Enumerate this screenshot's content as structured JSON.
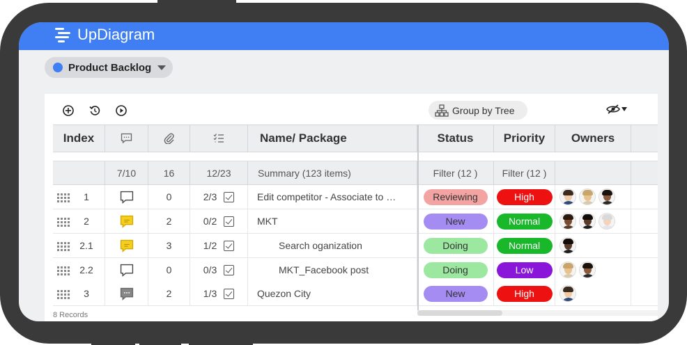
{
  "app": {
    "title": "UpDiagram"
  },
  "project": {
    "label": "Product Backlog",
    "color": "#3f7ef3"
  },
  "toolbar": {
    "add_icon": "add-circle-icon",
    "history_icon": "history-icon",
    "play_icon": "play-circle-icon",
    "group_by_label": "Group by Tree",
    "hide_icon": "eye-hidden-icon"
  },
  "columns": {
    "index": "Index",
    "comments": "comment-icon",
    "attachments": "paperclip-icon",
    "subtasks": "checklist-icon",
    "name": "Name/ Package",
    "status": "Status",
    "priority": "Priority",
    "owners": "Owners"
  },
  "summary": {
    "comments": "7/10",
    "attachments": "16",
    "subtasks": "12/23",
    "name": "Summary (123 items)",
    "status": "Filter (12 )",
    "priority": "Filter (12 )"
  },
  "rows": [
    {
      "index": "1",
      "comment_state": "empty",
      "attachments": "0",
      "subtasks": "2/3",
      "name": "Edit competitor - Associate to …",
      "indent": 0,
      "status": "Reviewing",
      "priority": "High",
      "owners": 3
    },
    {
      "index": "2",
      "comment_state": "new",
      "attachments": "2",
      "subtasks": "0/2",
      "name": "MKT",
      "indent": 0,
      "status": "New",
      "priority": "Normal",
      "owners": 3
    },
    {
      "index": "2.1",
      "comment_state": "new",
      "attachments": "3",
      "subtasks": "1/2",
      "name": "Search oganization",
      "indent": 1,
      "status": "Doing",
      "priority": "Normal",
      "owners": 1
    },
    {
      "index": "2.2",
      "comment_state": "empty",
      "attachments": "0",
      "subtasks": "0/3",
      "name": "MKT_Facebook post",
      "indent": 1,
      "status": "Doing",
      "priority": "Low",
      "owners": 2
    },
    {
      "index": "3",
      "comment_state": "read",
      "attachments": "2",
      "subtasks": "1/3",
      "name": "Quezon City",
      "indent": 0,
      "status": "New",
      "priority": "High",
      "owners": 1
    }
  ],
  "status_colors": {
    "Reviewing": "#f4a3a3",
    "New": "#a58cf3",
    "Doing": "#9ce8a0"
  },
  "priority_colors": {
    "High": "#ee1111",
    "Normal": "#19b72a",
    "Low": "#8a16d9"
  },
  "footer": {
    "records": "8 Records"
  }
}
